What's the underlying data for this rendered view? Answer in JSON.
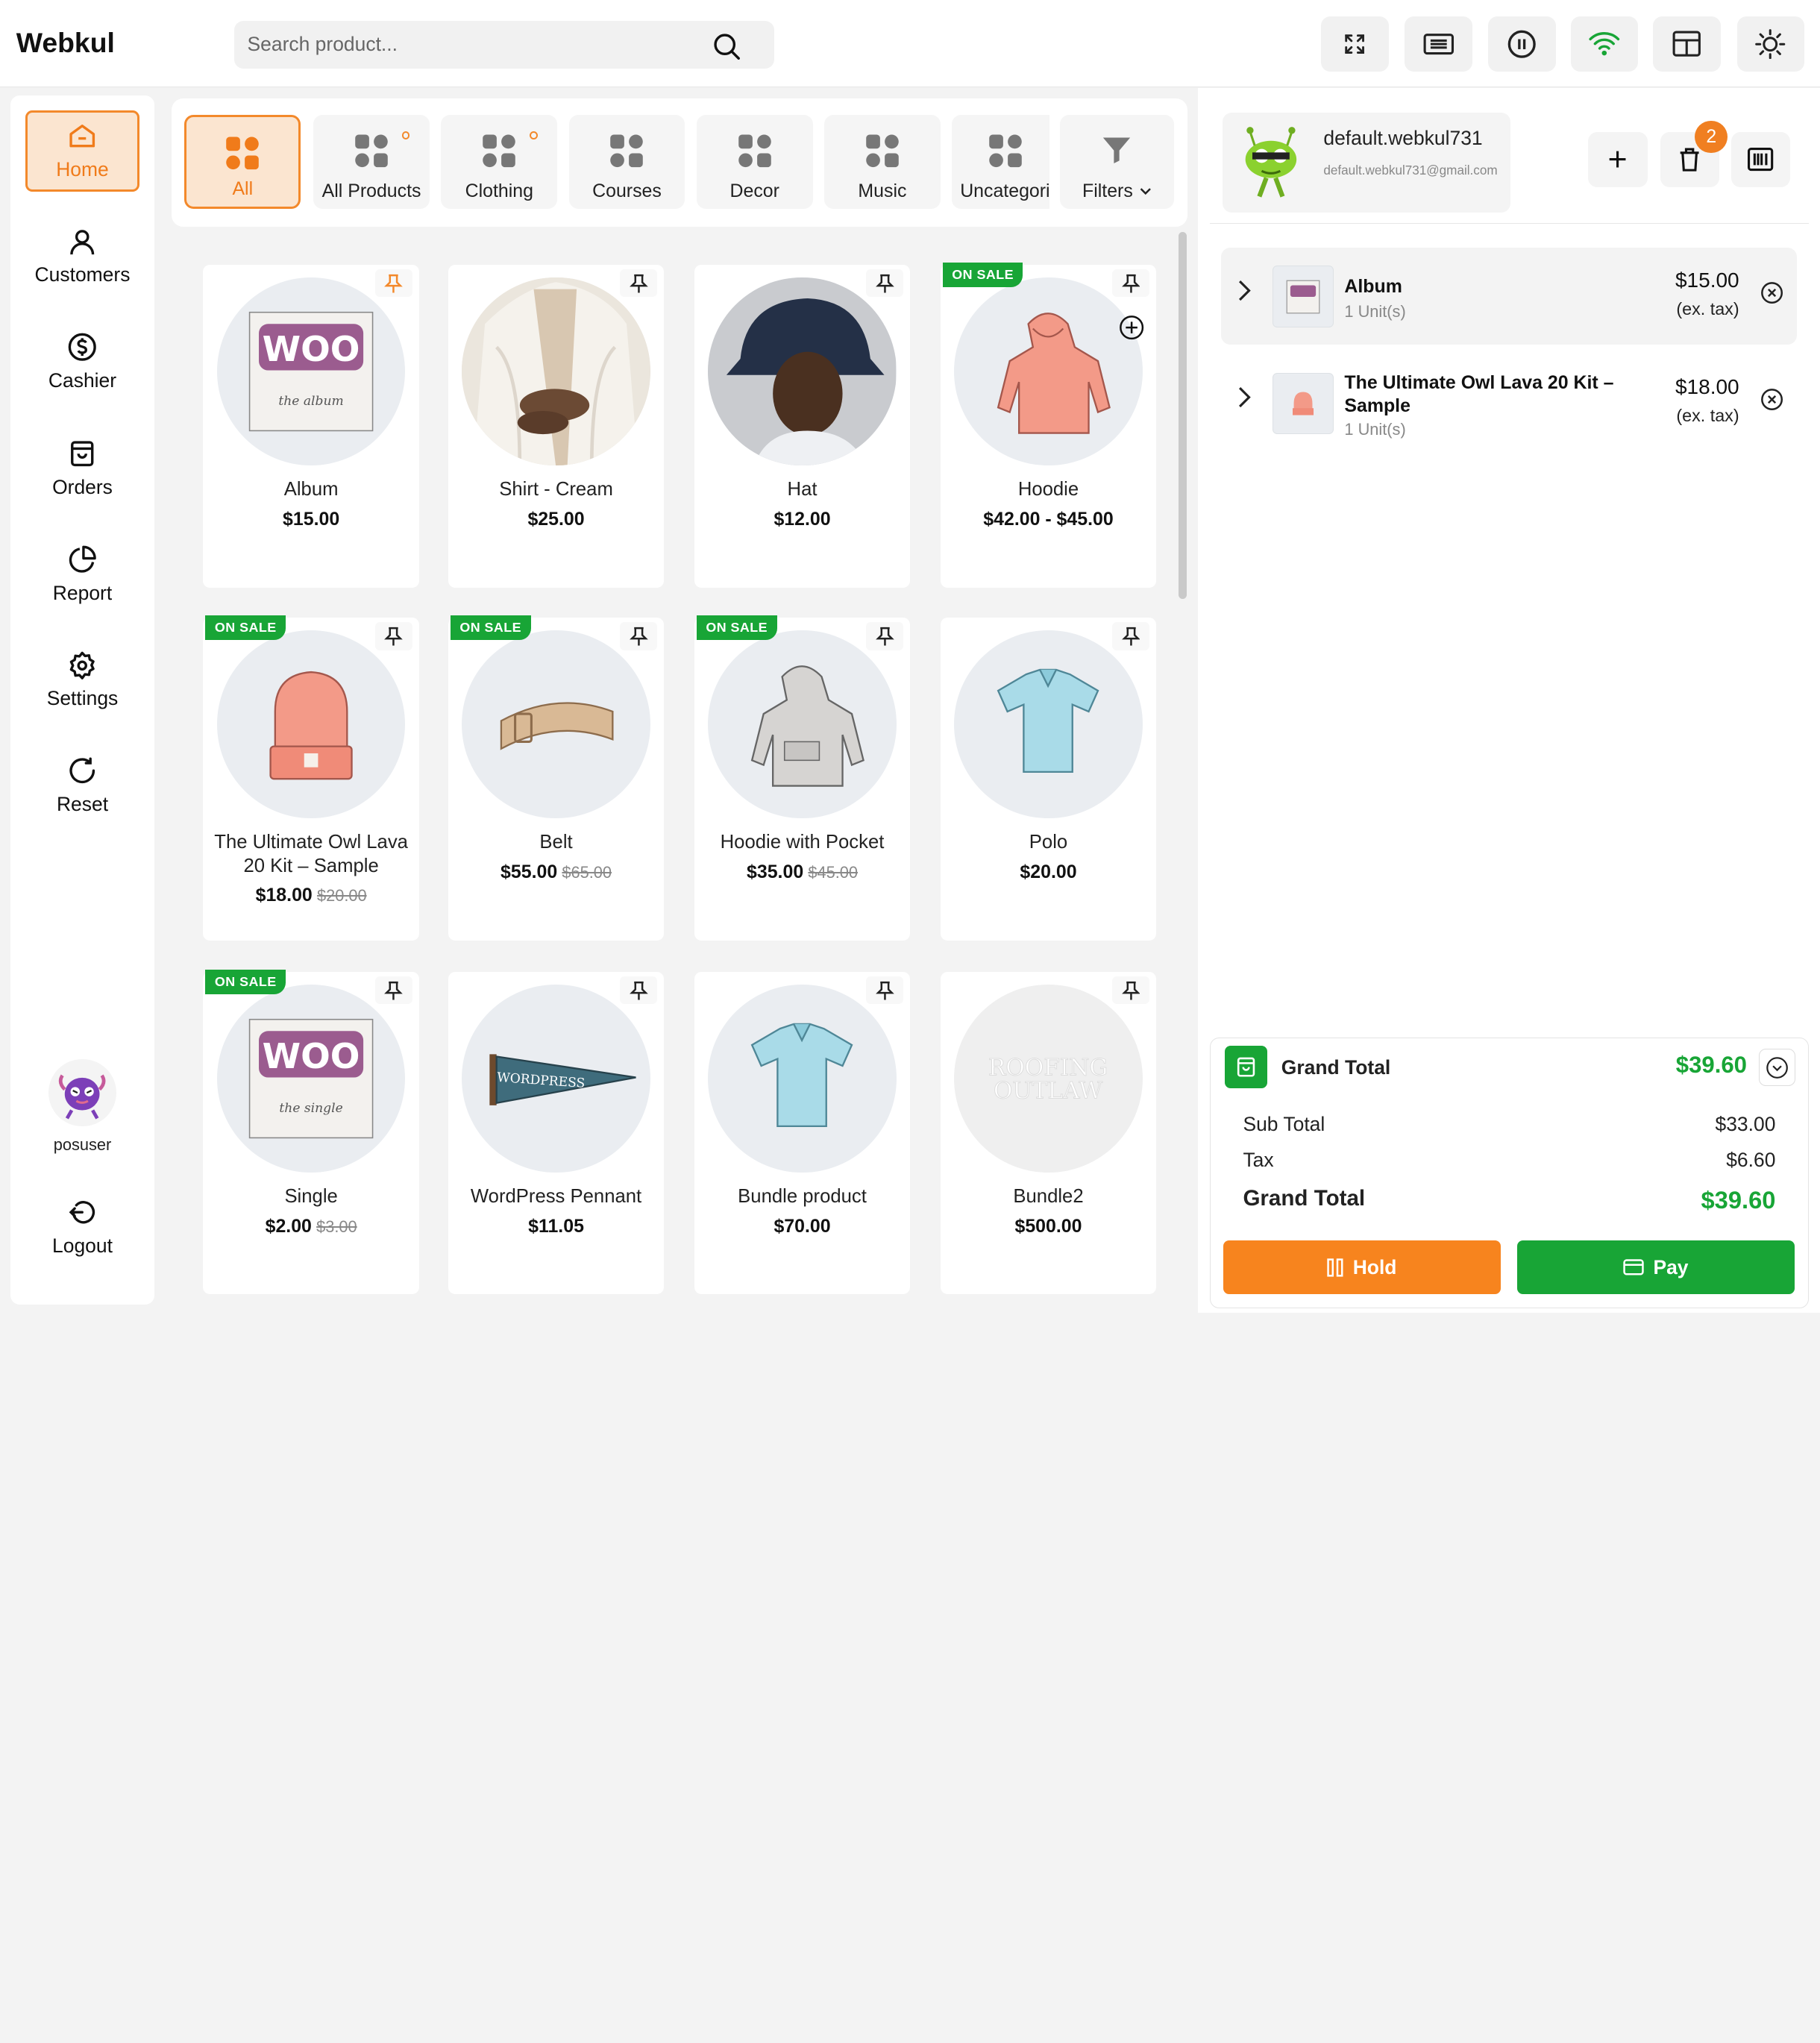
{
  "app": {
    "brand": "Webkul"
  },
  "search": {
    "placeholder": "Search product..."
  },
  "topbar": {
    "icons": [
      "fullscreen-icon",
      "keyboard-icon",
      "pause-icon",
      "wifi-icon",
      "layout-icon",
      "sun-icon"
    ],
    "wifi_color": "#18a536"
  },
  "colors": {
    "accent": "#f3892b",
    "success": "#18a536",
    "sale": "#18a536"
  },
  "sidebar": {
    "items": [
      {
        "label": "Home",
        "icon": "home-icon"
      },
      {
        "label": "Customers",
        "icon": "user-icon"
      },
      {
        "label": "Cashier",
        "icon": "dollar-icon"
      },
      {
        "label": "Orders",
        "icon": "bag-icon"
      },
      {
        "label": "Report",
        "icon": "pie-chart-icon"
      },
      {
        "label": "Settings",
        "icon": "gear-icon"
      },
      {
        "label": "Reset",
        "icon": "reset-icon"
      }
    ],
    "username": "posuser",
    "logout": "Logout"
  },
  "categories": [
    {
      "label": "All"
    },
    {
      "label": "All Products"
    },
    {
      "label": "Clothing"
    },
    {
      "label": "Courses"
    },
    {
      "label": "Decor"
    },
    {
      "label": "Music"
    },
    {
      "label": "Uncategorized"
    },
    {
      "label": "Filters"
    }
  ],
  "products": [
    {
      "name": "Album",
      "price": "$15.00",
      "old": "",
      "sale": false
    },
    {
      "name": "Shirt - Cream",
      "price": "$25.00",
      "old": "",
      "sale": false
    },
    {
      "name": "Hat",
      "price": "$12.00",
      "old": "",
      "sale": false
    },
    {
      "name": "Hoodie",
      "price": "$42.00 - $45.00",
      "old": "",
      "sale": true
    },
    {
      "name": "The Ultimate Owl Lava 20 Kit – Sample",
      "price": "$18.00",
      "old": "$20.00",
      "sale": true
    },
    {
      "name": "Belt",
      "price": "$55.00",
      "old": "$65.00",
      "sale": true
    },
    {
      "name": "Hoodie with Pocket",
      "price": "$35.00",
      "old": "$45.00",
      "sale": true
    },
    {
      "name": "Polo",
      "price": "$20.00",
      "old": "",
      "sale": false
    },
    {
      "name": "Single",
      "price": "$2.00",
      "old": "$3.00",
      "sale": true
    },
    {
      "name": "WordPress Pennant",
      "price": "$11.05",
      "old": "",
      "sale": false
    },
    {
      "name": "Bundle product",
      "price": "$70.00",
      "old": "",
      "sale": false
    },
    {
      "name": "Bundle2",
      "price": "$500.00",
      "old": "",
      "sale": false
    }
  ],
  "product_image_text": {
    "woo": "WOO",
    "album": "the album",
    "single": "the single",
    "pennant": "WORDPRESS",
    "roofing": [
      "ROOFING",
      "OUTLAW"
    ]
  },
  "sale_label": "ON SALE",
  "customer": {
    "name": "default.webkul731",
    "email": "default.webkul731@gmail.com"
  },
  "cart_count": "2",
  "cart": [
    {
      "name": "Album",
      "units": "1 Unit(s)",
      "price": "$15.00",
      "tax": "(ex. tax)"
    },
    {
      "name": "The Ultimate Owl Lava 20 Kit – Sample",
      "units": "1 Unit(s)",
      "price": "$18.00",
      "tax": "(ex. tax)"
    }
  ],
  "totals": {
    "grand_label": "Grand Total",
    "grand": "$39.60",
    "subtotal_label": "Sub Total",
    "subtotal": "$33.00",
    "tax_label": "Tax",
    "tax": "$6.60"
  },
  "actions": {
    "hold": "Hold",
    "pay": "Pay",
    "hold_color": "#f7841e",
    "pay_color": "#18a536"
  }
}
